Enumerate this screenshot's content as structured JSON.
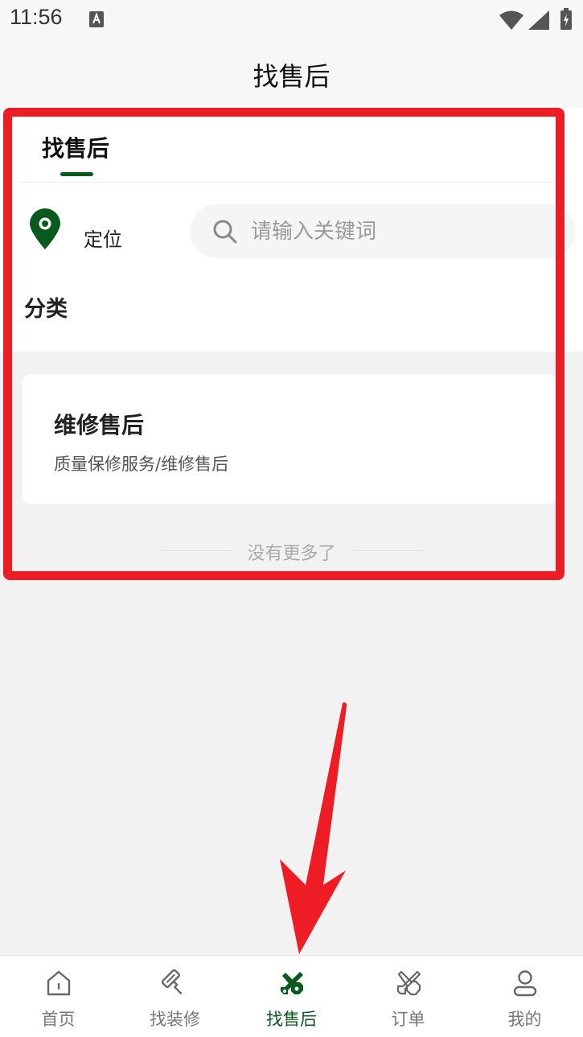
{
  "status_bar": {
    "time": "11:56"
  },
  "header": {
    "title": "找售后"
  },
  "tabs": [
    {
      "label": "找售后"
    }
  ],
  "location": {
    "label": "定位",
    "icon": "map-pin-icon"
  },
  "search": {
    "placeholder": "请输入关键词",
    "value": ""
  },
  "category": {
    "label": "分类"
  },
  "service_card": {
    "title": "维修售后",
    "subtitle": "质量保修服务/维修售后"
  },
  "list_footer": {
    "text": "没有更多了"
  },
  "bottom_nav": {
    "items": [
      {
        "label": "首页",
        "icon": "home-icon"
      },
      {
        "label": "找装修",
        "icon": "paint-roller-icon"
      },
      {
        "label": "找售后",
        "icon": "tools-icon",
        "active": true
      },
      {
        "label": "订单",
        "icon": "wrench-screwdriver-icon"
      },
      {
        "label": "我的",
        "icon": "user-icon"
      }
    ]
  },
  "colors": {
    "brand_green": "#0a5a1f",
    "highlight_red": "#ee1c25",
    "background": "#f3f2f3"
  }
}
